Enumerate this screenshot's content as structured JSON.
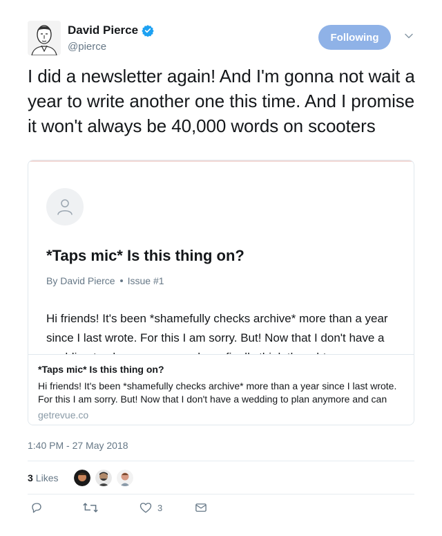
{
  "user": {
    "display_name": "David Pierce",
    "handle": "@pierce",
    "verified": true
  },
  "follow_button": {
    "label": "Following"
  },
  "tweet": {
    "text": "I did a newsletter again! And I'm gonna not wait a year to write another one this time. And I promise it won't always be 40,000 words on scooters"
  },
  "card": {
    "preview": {
      "title": "*Taps mic* Is this thing on?",
      "author": "By David Pierce",
      "issue": "Issue #1",
      "body": "Hi friends! It's been *shamefully checks archive* more than a year since I last wrote. For this I am sorry. But! Now that I don't have a wedding to plan anymore and can finally think thoughts"
    },
    "title": "*Taps mic* Is this thing on?",
    "description": "Hi friends! It's been *shamefully checks archive* more than a year since I last wrote. For this I am sorry. But! Now that I don't have a wedding to plan anymore and can",
    "domain": "getrevue.co"
  },
  "timestamp": "1:40 PM - 27 May 2018",
  "likes": {
    "count": "3",
    "label": "Likes"
  },
  "actions": {
    "reply_count": "",
    "retweet_count": "",
    "like_count": "3"
  },
  "colors": {
    "accent": "#1da1f2",
    "follow_button_bg": "#8fb2e7",
    "muted_text": "#657786"
  }
}
